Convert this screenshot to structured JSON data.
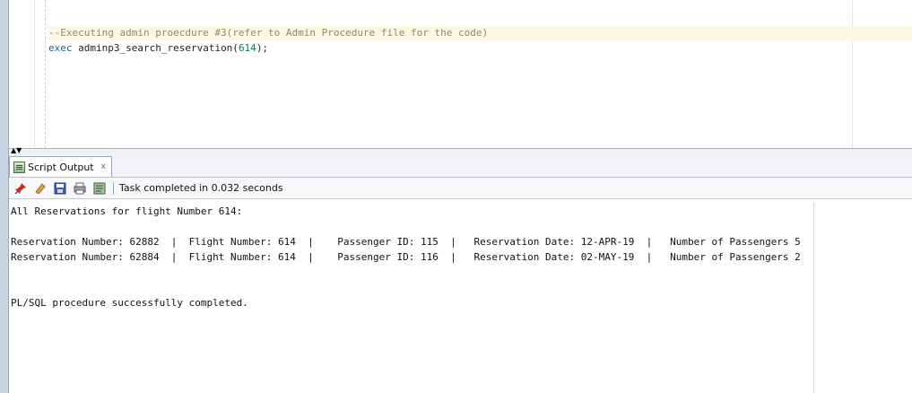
{
  "editor": {
    "comment_line": "--Executing admin proecdure #3(refer to Admin Procedure file for the code)",
    "exec_keyword": "exec",
    "exec_proc": " adminp3_search_reservation(",
    "exec_arg": "614",
    "exec_end": ");"
  },
  "tab": {
    "label": "Script Output",
    "close": "x"
  },
  "toolbar": {
    "status": "Task completed in 0.032 seconds",
    "icons": [
      "pin-icon",
      "eraser-icon",
      "save-icon",
      "print-icon",
      "script-icon"
    ]
  },
  "output": {
    "header": "All Reservations for flight Number 614:",
    "rows": [
      "Reservation Number: 62882  |  Flight Number: 614  |    Passenger ID: 115  |   Reservation Date: 12-APR-19  |   Number of Passengers 5",
      "Reservation Number: 62884  |  Flight Number: 614  |    Passenger ID: 116  |   Reservation Date: 02-MAY-19  |   Number of Passengers 2"
    ],
    "footer": "PL/SQL procedure successfully completed."
  }
}
